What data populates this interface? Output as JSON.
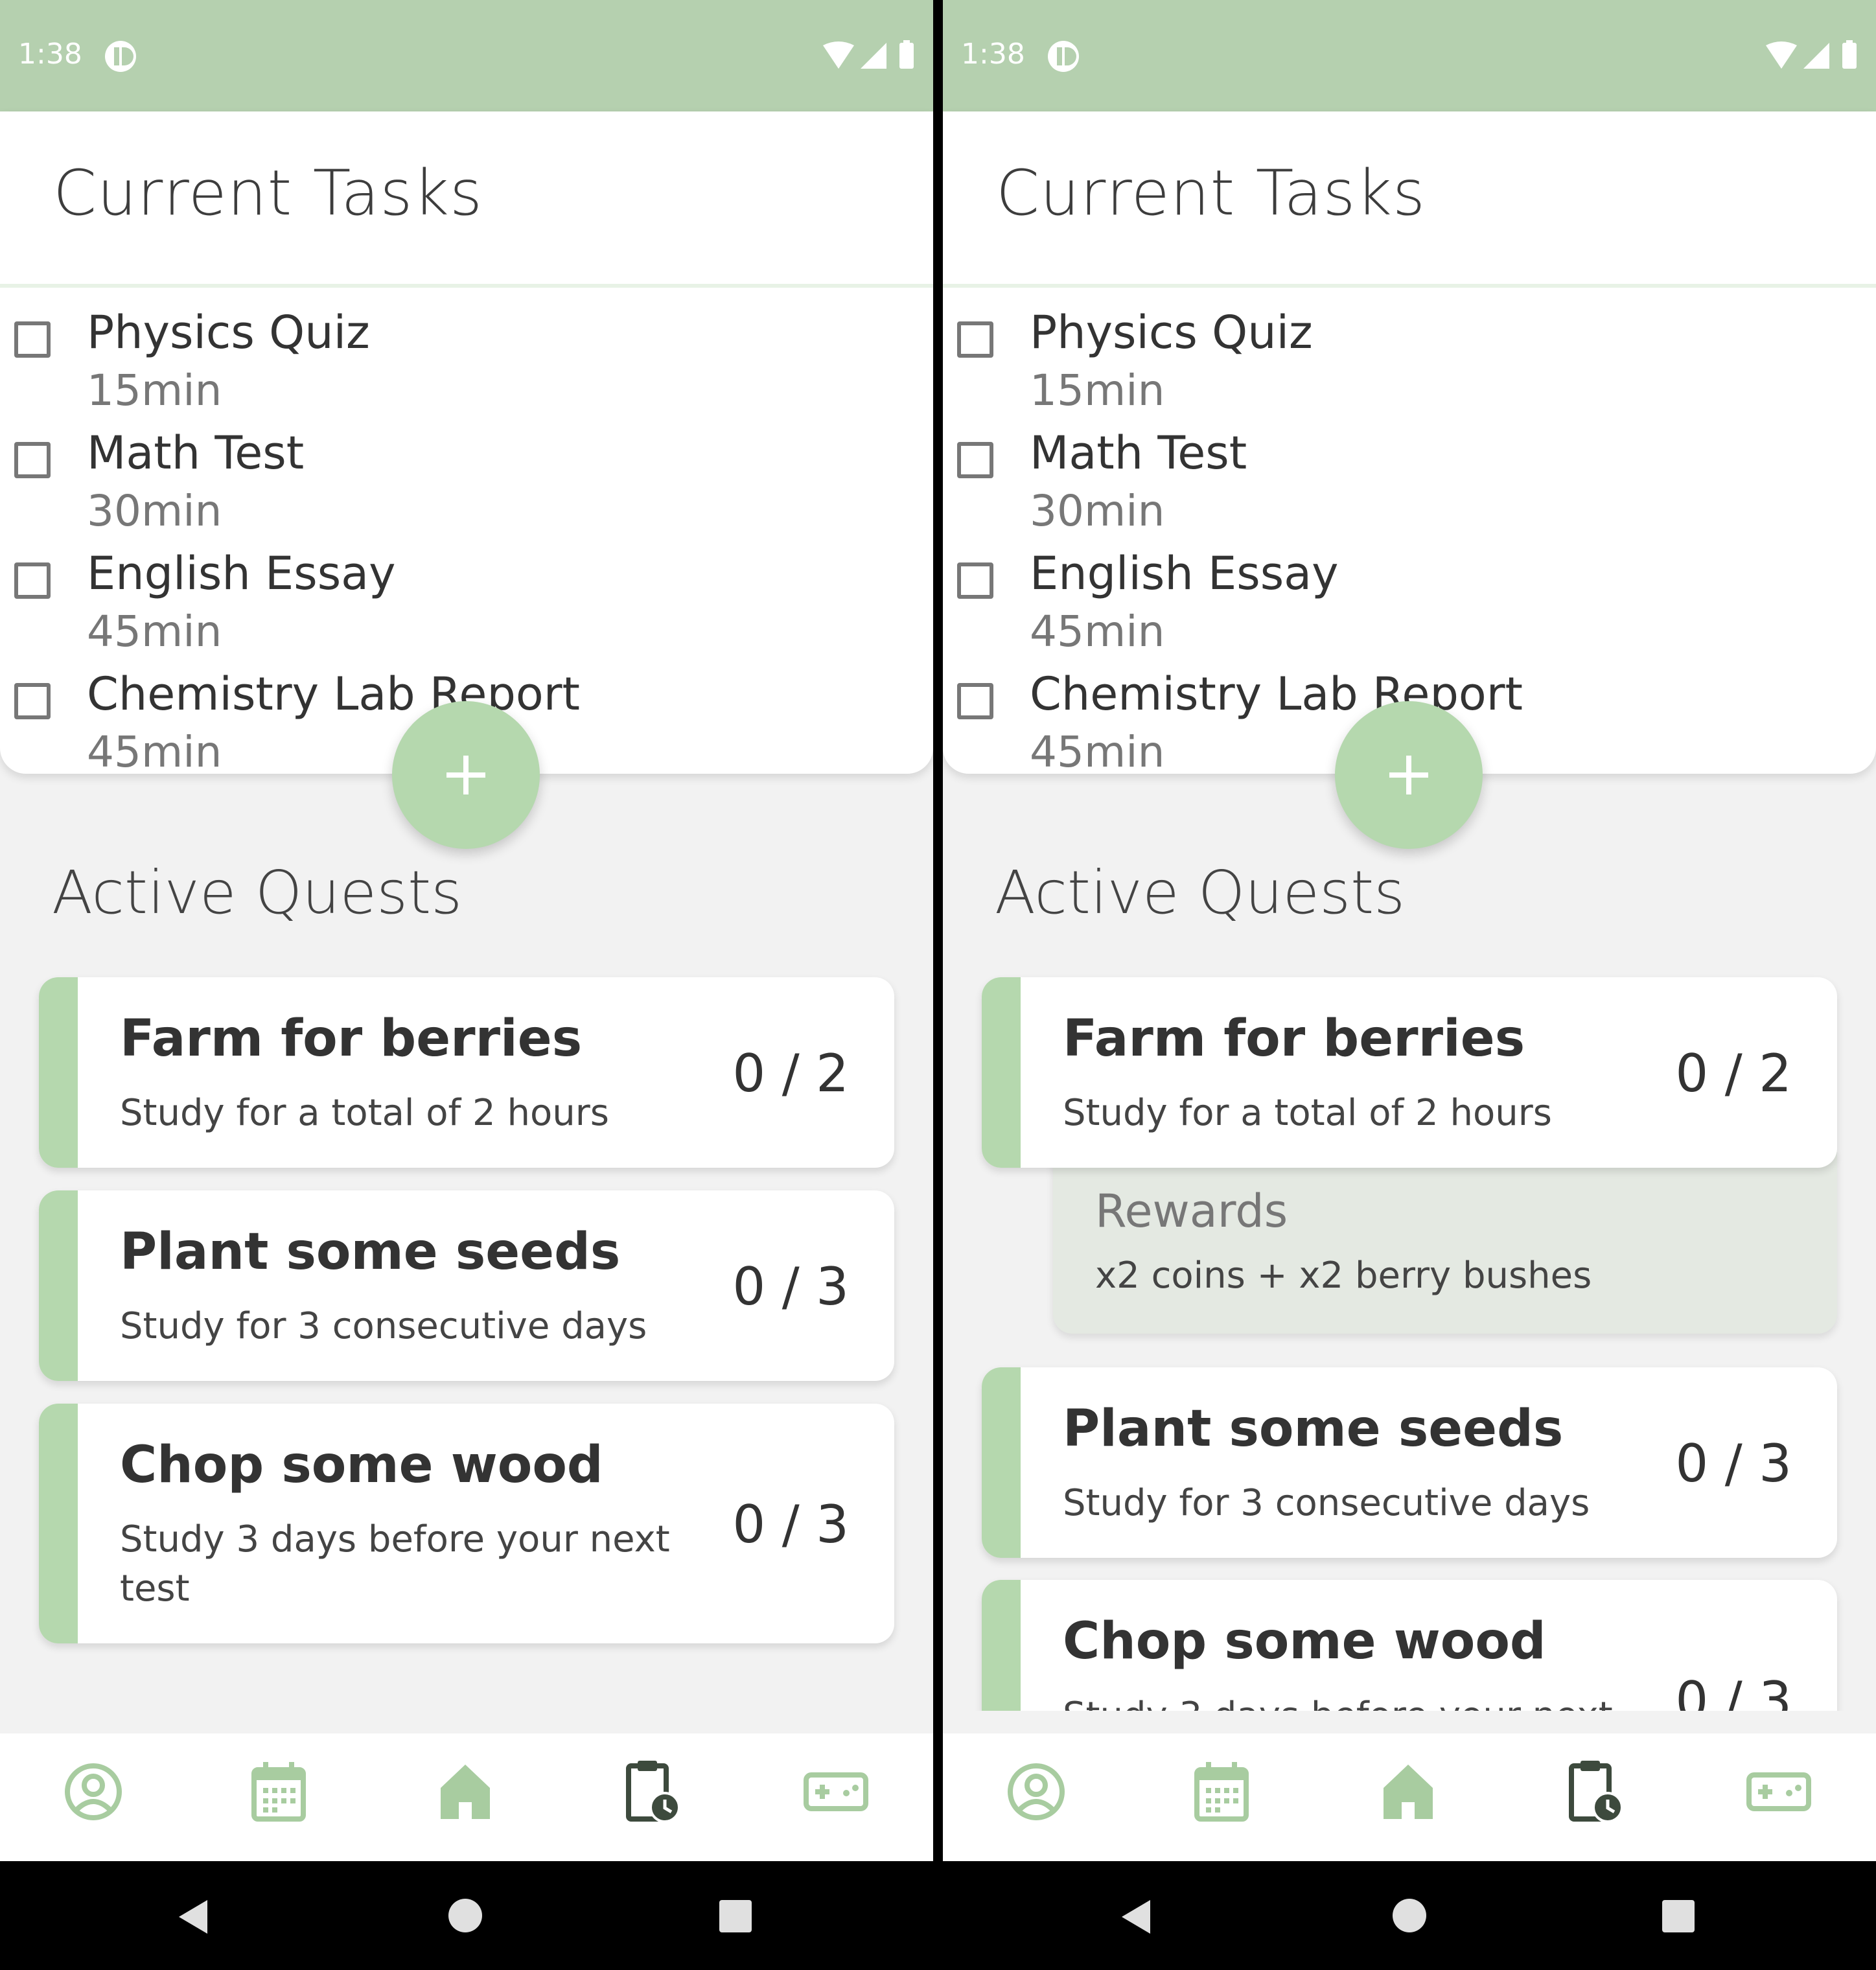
{
  "status_bar": {
    "time": "1:38"
  },
  "tasks": {
    "title": "Current Tasks",
    "items": [
      {
        "name": "Physics Quiz",
        "duration": "15min"
      },
      {
        "name": "Math Test",
        "duration": "30min"
      },
      {
        "name": "English Essay",
        "duration": "45min"
      },
      {
        "name": "Chemistry Lab Report",
        "duration": "45min"
      }
    ]
  },
  "quests": {
    "title": "Active Quests",
    "items": [
      {
        "title": "Farm for berries",
        "description": "Study for a total of 2 hours",
        "progress": "0 / 2"
      },
      {
        "title": "Plant some seeds",
        "description": "Study for 3 consecutive days",
        "progress": "0 / 3"
      },
      {
        "title": "Chop some wood",
        "description": "Study 3 days before your next test",
        "progress": "0 / 3"
      }
    ],
    "rewards": {
      "title": "Rewards",
      "text": "x2 coins + x2 berry bushes"
    }
  },
  "bottom_nav": {
    "items": [
      "profile-icon",
      "calendar-icon",
      "home-icon",
      "tasks-clipboard-icon",
      "games-icon"
    ],
    "active_index": 3
  },
  "colors": {
    "accent_green": "#b5d8ae",
    "status_bar": "#b5d0af",
    "nav_icon": "#a8cca0",
    "nav_icon_active": "#3d4a3d",
    "rewards_bg": "#e4e9e2"
  }
}
